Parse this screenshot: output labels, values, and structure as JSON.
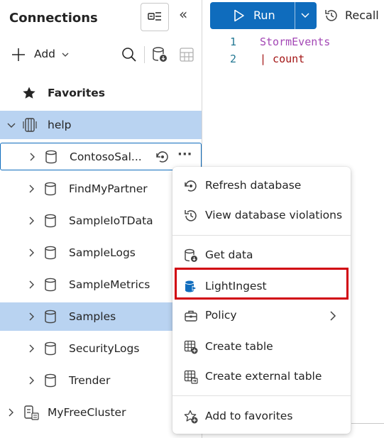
{
  "header": {
    "title": "Connections",
    "collapse_glyph": "«"
  },
  "toolbar": {
    "add_label": "Add"
  },
  "tree": {
    "favorites_label": "Favorites",
    "cluster_label": "help",
    "databases": [
      "ContosoSal...",
      "FindMyPartner",
      "SampleIoTData",
      "SampleLogs",
      "SampleMetrics",
      "Samples",
      "SecurityLogs",
      "Trender"
    ],
    "other_cluster_label": "MyFreeCluster"
  },
  "editor": {
    "run_label": "Run",
    "recall_label": "Recall",
    "lines": [
      {
        "number": "1",
        "text": "StormEvents"
      },
      {
        "number": "2",
        "text": "| count"
      }
    ]
  },
  "context_menu": {
    "items": [
      {
        "label": "Refresh database",
        "icon": "refresh-database-icon"
      },
      {
        "label": "View database violations",
        "icon": "history-icon"
      },
      {
        "label": "Get data",
        "icon": "get-data-icon"
      },
      {
        "label": "LightIngest",
        "icon": "lightingest-icon"
      },
      {
        "label": "Policy",
        "icon": "briefcase-icon"
      },
      {
        "label": "Create table",
        "icon": "create-table-icon"
      },
      {
        "label": "Create external table",
        "icon": "create-external-table-icon"
      },
      {
        "label": "Add to favorites",
        "icon": "star-add-icon"
      }
    ]
  },
  "colors": {
    "accent": "#0f6cbd",
    "selection": "#b9d3f1",
    "highlight_box": "#d1000f",
    "keyword": "#a31515",
    "table_name": "#a347b5"
  }
}
